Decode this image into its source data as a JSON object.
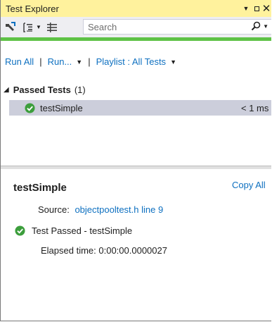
{
  "window": {
    "title": "Test Explorer"
  },
  "toolbar": {
    "search_placeholder": "Search"
  },
  "commands": {
    "run_all": "Run All",
    "separator": "|",
    "run": "Run...",
    "playlist": "Playlist : All Tests"
  },
  "colors": {
    "titlebar": "#fff29d",
    "toolbar": "#eeeef2",
    "progress": "#5ec246",
    "link": "#0e70c0",
    "selected_row": "#cccedb",
    "pass": "#3c9e3c"
  },
  "tree": {
    "group_name": "Passed Tests",
    "group_count": "(1)",
    "tests": [
      {
        "name": "testSimple",
        "duration": "< 1 ms",
        "status": "passed"
      }
    ]
  },
  "details": {
    "title": "testSimple",
    "copy_all": "Copy All",
    "source_label": "Source:",
    "source_link": "objectpooltest.h line 9",
    "result": "Test Passed - testSimple",
    "elapsed": "Elapsed time: 0:00:00.0000027"
  },
  "progress": {
    "fraction": 1.0
  }
}
